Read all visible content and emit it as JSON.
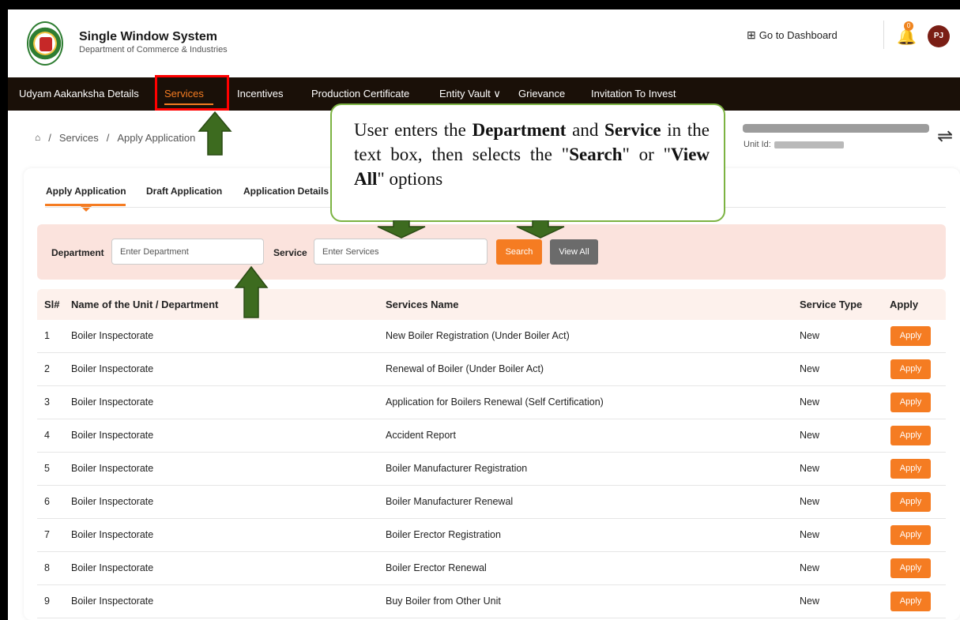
{
  "header": {
    "title": "Single Window System",
    "subtitle": "Department of Commerce & Industries",
    "dashboard_link": "Go to Dashboard",
    "notification_count": "0",
    "avatar_initials": "PJ"
  },
  "nav": {
    "items": [
      {
        "label": "Udyam Aakanksha Details"
      },
      {
        "label": "Services"
      },
      {
        "label": "Incentives"
      },
      {
        "label": "Production Certificate"
      },
      {
        "label": "Entity Vault"
      },
      {
        "label": "Grievance"
      },
      {
        "label": "Invitation To Invest"
      }
    ],
    "entity_vault_caret": "∨",
    "active": "Services"
  },
  "breadcrumb": {
    "items": [
      "Services",
      "Apply Application"
    ],
    "separator": "/"
  },
  "unit": {
    "id_label": "Unit Id:"
  },
  "tabs": {
    "items": [
      "Apply Application",
      "Draft Application",
      "Application Details"
    ],
    "active": "Apply Application"
  },
  "filter": {
    "department_label": "Department",
    "department_placeholder": "Enter Department",
    "service_label": "Service",
    "service_placeholder": "Enter Services",
    "search_label": "Search",
    "view_all_label": "View All"
  },
  "table": {
    "headers": [
      "Sl#",
      "Name of the Unit / Department",
      "Services Name",
      "Service Type",
      "Apply"
    ],
    "rows": [
      {
        "sl": "1",
        "department": "Boiler Inspectorate",
        "service": "New Boiler Registration (Under Boiler Act)",
        "type": "New",
        "apply": "Apply"
      },
      {
        "sl": "2",
        "department": "Boiler Inspectorate",
        "service": "Renewal of Boiler (Under Boiler Act)",
        "type": "New",
        "apply": "Apply"
      },
      {
        "sl": "3",
        "department": "Boiler Inspectorate",
        "service": "Application for Boilers Renewal (Self Certification)",
        "type": "New",
        "apply": "Apply"
      },
      {
        "sl": "4",
        "department": "Boiler Inspectorate",
        "service": "Accident Report",
        "type": "New",
        "apply": "Apply"
      },
      {
        "sl": "5",
        "department": "Boiler Inspectorate",
        "service": "Boiler Manufacturer Registration",
        "type": "New",
        "apply": "Apply"
      },
      {
        "sl": "6",
        "department": "Boiler Inspectorate",
        "service": "Boiler Manufacturer Renewal",
        "type": "New",
        "apply": "Apply"
      },
      {
        "sl": "7",
        "department": "Boiler Inspectorate",
        "service": "Boiler Erector Registration",
        "type": "New",
        "apply": "Apply"
      },
      {
        "sl": "8",
        "department": "Boiler Inspectorate",
        "service": "Boiler Erector Renewal",
        "type": "New",
        "apply": "Apply"
      },
      {
        "sl": "9",
        "department": "Boiler Inspectorate",
        "service": "Buy Boiler from Other Unit",
        "type": "New",
        "apply": "Apply"
      }
    ]
  },
  "callout": {
    "part1": "User enters the ",
    "bold1": "Department",
    "part2": " and ",
    "bold2": "Service",
    "part3": " in the text box, then selects the \"",
    "bold3": "Search",
    "part4": "\" or \"",
    "bold4": "View All",
    "part5": "\" options"
  },
  "colors": {
    "accent": "#f57c22",
    "nav_bg": "#1a1008",
    "filter_bg": "#fbe3dd",
    "highlight_box": "#ff0000",
    "annotation_arrow": "#3d6b1f",
    "callout_border": "#7cb342"
  }
}
